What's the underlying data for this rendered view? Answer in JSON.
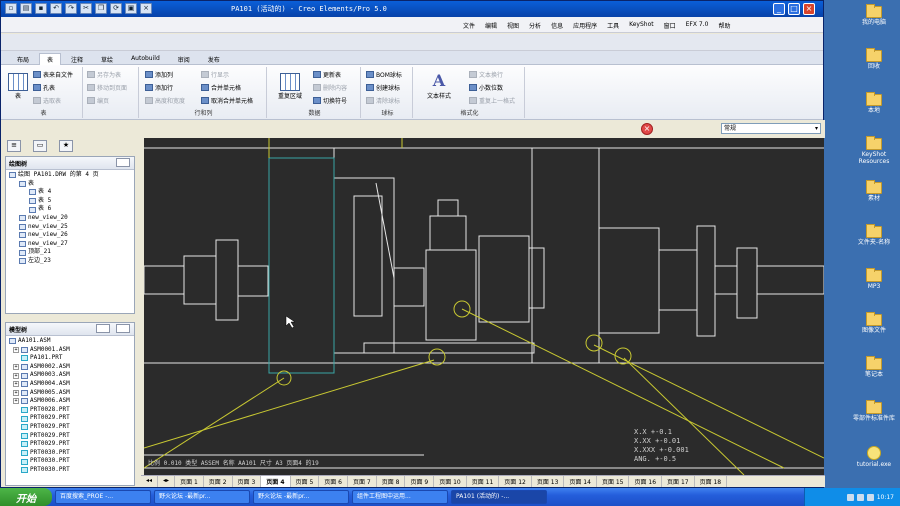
{
  "window": {
    "title": "PA101 (活动的) - Creo Elements/Pro 5.0",
    "menus": [
      "文件",
      "编辑",
      "视图",
      "分析",
      "信息",
      "应用程序",
      "工具",
      "KeyShot",
      "窗口",
      "EFX 7.0",
      "帮助"
    ]
  },
  "ribbon": {
    "tabs": [
      "布局",
      "表",
      "注释",
      "草绘",
      "Autobuild",
      "审阅",
      "发布"
    ],
    "active_tab": "表",
    "groups": {
      "table": {
        "label": "表",
        "items": [
          "表",
          "表来自文件",
          "孔表",
          "选取表",
          "另存为表",
          "移动到页面",
          "编页"
        ]
      },
      "rows_cols": {
        "label": "行和列",
        "items": [
          "添加列",
          "添加行",
          "高度和宽度",
          "行显示",
          "合并单元格",
          "取消合并单元格"
        ]
      },
      "data": {
        "label": "数据",
        "items": [
          "重复区域",
          "更新表",
          "删除内容",
          "切换符号"
        ]
      },
      "balloon": {
        "label": "球标",
        "items": [
          "BOM球标",
          "创建球标",
          "清除球标"
        ]
      },
      "format": {
        "label": "格式化",
        "items": [
          "文本样式",
          "文本换行",
          "小数位数",
          "重复上一格式"
        ]
      }
    }
  },
  "left_panel": {
    "drawing_tree": {
      "title": "绘图树",
      "items": [
        {
          "label": "绘图 PA101.DRW 的第 4 页",
          "level": 0
        },
        {
          "label": "表",
          "level": 1
        },
        {
          "label": "表 4",
          "level": 2
        },
        {
          "label": "表 5",
          "level": 2
        },
        {
          "label": "表 6",
          "level": 2
        },
        {
          "label": "new_view_20",
          "level": 1
        },
        {
          "label": "new_view_25",
          "level": 1
        },
        {
          "label": "new_view_26",
          "level": 1
        },
        {
          "label": "new_view_27",
          "level": 1
        },
        {
          "label": "顶部_21",
          "level": 1
        },
        {
          "label": "左边_23",
          "level": 1
        }
      ]
    },
    "model_tree": {
      "title": "模型树",
      "items": [
        "AA101.ASM",
        "ASM0001.ASM",
        "PA101.PRT",
        "ASM0002.ASM",
        "ASM0003.ASM",
        "ASM0004.ASM",
        "ASM0005.ASM",
        "ASM0006.ASM",
        "PRT0028.PRT",
        "PRT0029.PRT",
        "PRT0029.PRT",
        "PRT0029.PRT",
        "PRT0029.PRT",
        "PRT0030.PRT",
        "PRT0030.PRT",
        "PRT0030.PRT"
      ]
    }
  },
  "canvas": {
    "scale_label": "常规",
    "title_block": "比例 0.010   类型 ASSEM   名称 AA101   尺寸 A3   页面4 的19",
    "tolerance": [
      "X.X   +-0.1",
      "X.XX   +-0.01",
      "X.XXX   +-0.001",
      "ANG.   +-0.5"
    ]
  },
  "sheet_tabs": [
    "页面 1",
    "页面 2",
    "页面 3",
    "页面 4",
    "页面 5",
    "页面 6",
    "页面 7",
    "页面 8",
    "页面 9",
    "页面 10",
    "页面 11",
    "页面 12",
    "页面 13",
    "页面 14",
    "页面 15",
    "页面 16",
    "页面 17",
    "页面 18"
  ],
  "active_sheet": "页面 4",
  "taskbar": {
    "start": "开始",
    "items": [
      "百度搜索_PROE -...",
      "野火论坛 -最新pr...",
      "野火论坛 -最新pr...",
      "组件工程图中运用...",
      "PA101 (活动的) -..."
    ],
    "clock": "10:17"
  },
  "desktop_icons": [
    "我的电脑",
    "回收",
    "本地",
    "KeyShot Resources",
    "素材",
    "文件夹-名称",
    "MP3",
    "图像文件",
    "笔记本",
    "零部件标准件库",
    "tutorial.exe"
  ],
  "colors": {
    "canvas_bg": "#2b2b2b",
    "drawing_line": "#e6e6e6",
    "leader_line": "#c8c832",
    "selection": "#3aa6a6",
    "title_blue": "#0842a8"
  }
}
